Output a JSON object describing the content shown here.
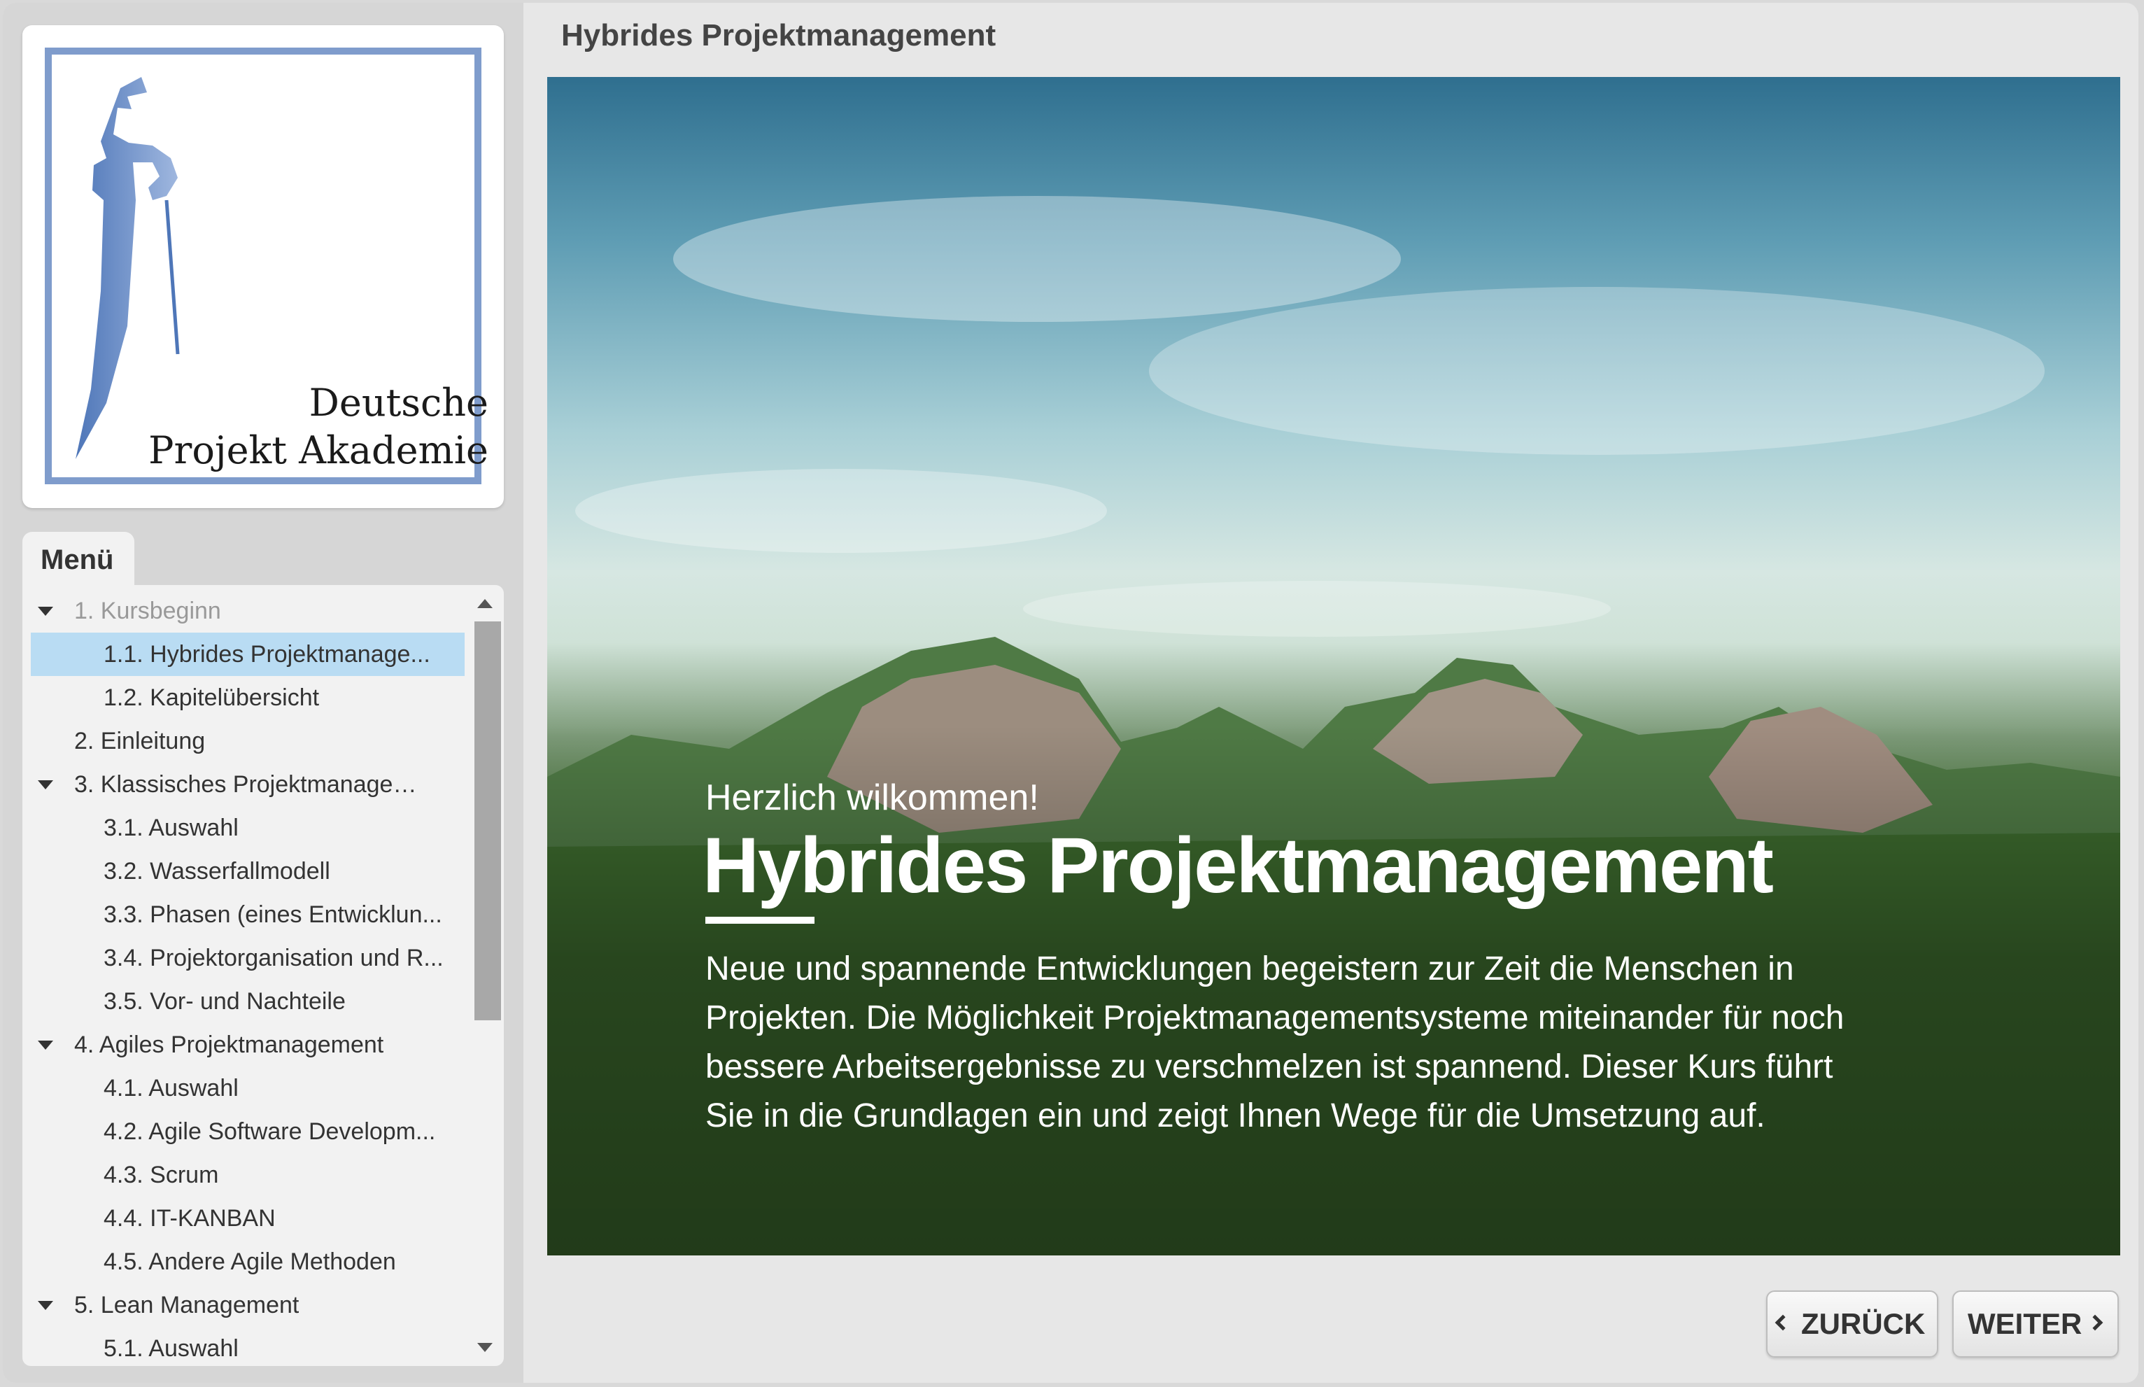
{
  "sidebar": {
    "logo": {
      "line1": "Deutsche",
      "line2": "Projekt Akademie"
    },
    "menu_tab": "Menü",
    "items": [
      {
        "label": "1. Kursbeginn",
        "level": 1,
        "expandable": true,
        "muted": true
      },
      {
        "label": "1.1. Hybrides Projektmanage...",
        "level": 2,
        "active": true
      },
      {
        "label": "1.2. Kapitelübersicht",
        "level": 2
      },
      {
        "label": "2. Einleitung",
        "level": 1
      },
      {
        "label": "3. Klassisches Projektmanageme...",
        "level": 1,
        "expandable": true
      },
      {
        "label": "3.1. Auswahl",
        "level": 2
      },
      {
        "label": "3.2. Wasserfallmodell",
        "level": 2
      },
      {
        "label": "3.3. Phasen (eines Entwicklun...",
        "level": 2
      },
      {
        "label": "3.4. Projektorganisation und R...",
        "level": 2
      },
      {
        "label": "3.5. Vor- und Nachteile",
        "level": 2
      },
      {
        "label": "4. Agiles Projektmanagement",
        "level": 1,
        "expandable": true
      },
      {
        "label": "4.1. Auswahl",
        "level": 2
      },
      {
        "label": "4.2. Agile Software Developm...",
        "level": 2
      },
      {
        "label": "4.3. Scrum",
        "level": 2
      },
      {
        "label": "4.4. IT-KANBAN",
        "level": 2
      },
      {
        "label": "4.5. Andere Agile Methoden",
        "level": 2
      },
      {
        "label": "5. Lean Management",
        "level": 1,
        "expandable": true
      },
      {
        "label": "5.1. Auswahl",
        "level": 2
      }
    ]
  },
  "main": {
    "title": "Hybrides Projektmanagement",
    "hero": {
      "kicker": "Herzlich wilkommen!",
      "title": "Hybrides Projektmanagement",
      "body": "Neue und spannende Entwicklungen begeistern zur Zeit die Menschen in Projekten. Die Möglichkeit Projektmanagementsysteme miteinander für noch bessere Arbeitsergebnisse zu verschmelzen ist spannend. Dieser Kurs führt Sie in die Grundlagen ein und zeigt Ihnen Wege für die Umsetzung auf."
    },
    "nav": {
      "back_label": "ZURÜCK",
      "next_label": "WEITER"
    }
  },
  "icons": {
    "logo": "tower-logo-icon",
    "caret": "caret-down-icon",
    "back": "chevron-left-icon",
    "next": "chevron-right-icon"
  },
  "colors": {
    "active_item": "#b9dcf3",
    "logo_border": "#7f9ccc",
    "sidebar_bg": "#d6d6d6"
  }
}
